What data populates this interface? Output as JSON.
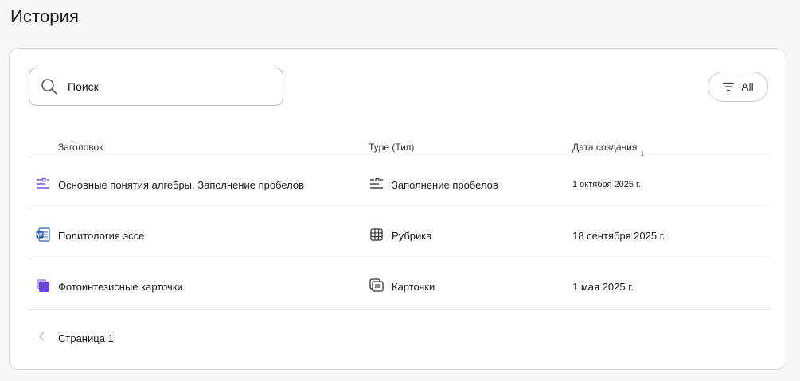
{
  "page": {
    "title": "История"
  },
  "search": {
    "placeholder": "Поиск"
  },
  "filter": {
    "label": "All"
  },
  "table": {
    "columns": {
      "title": "Заголовок",
      "type": "Type (Тип)",
      "date": "Дата создания"
    },
    "rows": [
      {
        "title": "Основные понятия алгебры. Заполнение пробелов",
        "type": "Заполнение пробелов",
        "date": "1 октября 2025 г.",
        "item_icon": "fill-blanks-icon",
        "type_icon": "fill-blanks-type-icon"
      },
      {
        "title": "Политология эссе",
        "type": "Рубрика",
        "date": "18 сентября 2025 г.",
        "item_icon": "word-doc-icon",
        "type_icon": "rubric-grid-icon"
      },
      {
        "title": "Фотоинтезисные карточки",
        "type": "Карточки",
        "date": "1 мая 2025 г.",
        "item_icon": "flashcards-icon",
        "type_icon": "cards-type-icon"
      }
    ]
  },
  "pager": {
    "label": "Страница 1"
  },
  "colors": {
    "accent": "#7b5cd6",
    "word_blue": "#2b5cb8",
    "border": "#d6d6d6"
  }
}
